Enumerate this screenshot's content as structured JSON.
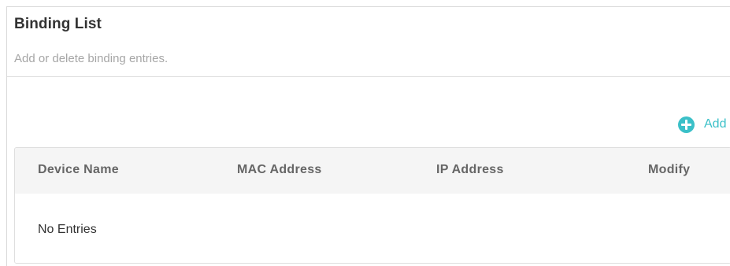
{
  "section": {
    "title": "Binding List",
    "description": "Add or delete binding entries."
  },
  "toolbar": {
    "add_label": "Add",
    "add_icon": "plus-circle-icon",
    "accent_color": "#3bc0c8"
  },
  "table": {
    "columns": [
      "Device Name",
      "MAC Address",
      "IP Address",
      "Modify"
    ],
    "rows": [],
    "empty_text": "No Entries"
  }
}
